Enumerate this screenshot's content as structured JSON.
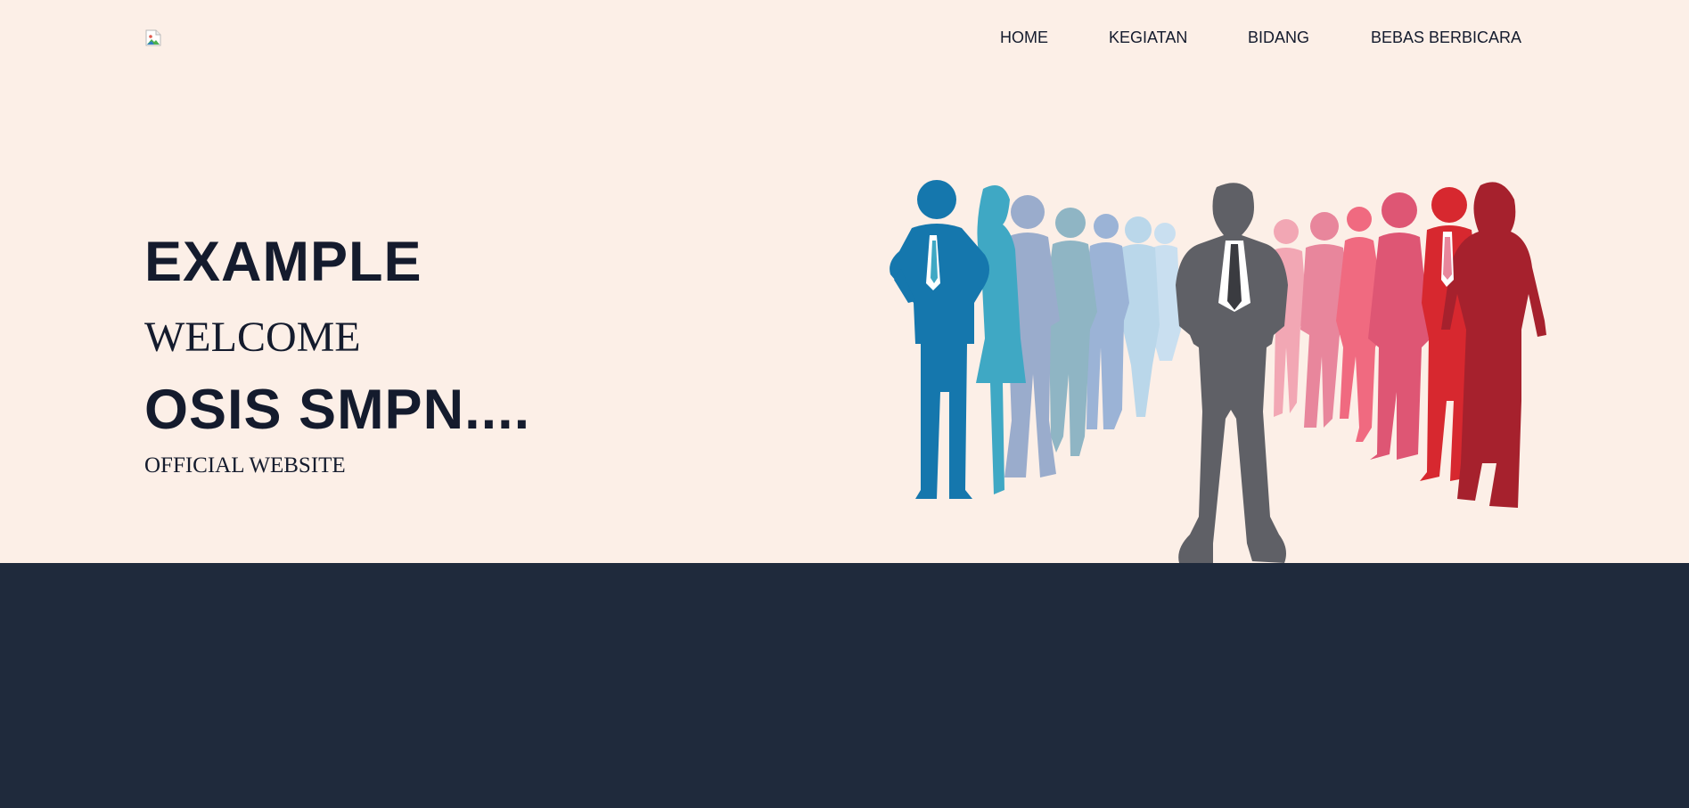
{
  "header": {
    "logo_icon": "broken-image-icon",
    "nav": [
      {
        "label": "HOME"
      },
      {
        "label": "KEGIATAN"
      },
      {
        "label": "BIDANG"
      },
      {
        "label": "BEBAS BERBICARA"
      }
    ]
  },
  "hero": {
    "line1": "EXAMPLE",
    "line2": "WELCOME",
    "line3": "OSIS SMPN....",
    "line4": "OFFICIAL WEBSITE",
    "illustration_icon": "business-people-silhouettes-icon"
  },
  "colors": {
    "hero_bg": "#fcefe7",
    "footer_bg": "#1f2a3c",
    "text": "#141b2d",
    "silhouettes": [
      "#1577ad",
      "#3fa8c4",
      "#9aaccc",
      "#8fb5c4",
      "#9bb3d6",
      "#bad7ea",
      "#5f6066",
      "#f2a7b4",
      "#e8869c",
      "#f06a80",
      "#de5674",
      "#d7282f",
      "#a6212d"
    ]
  }
}
